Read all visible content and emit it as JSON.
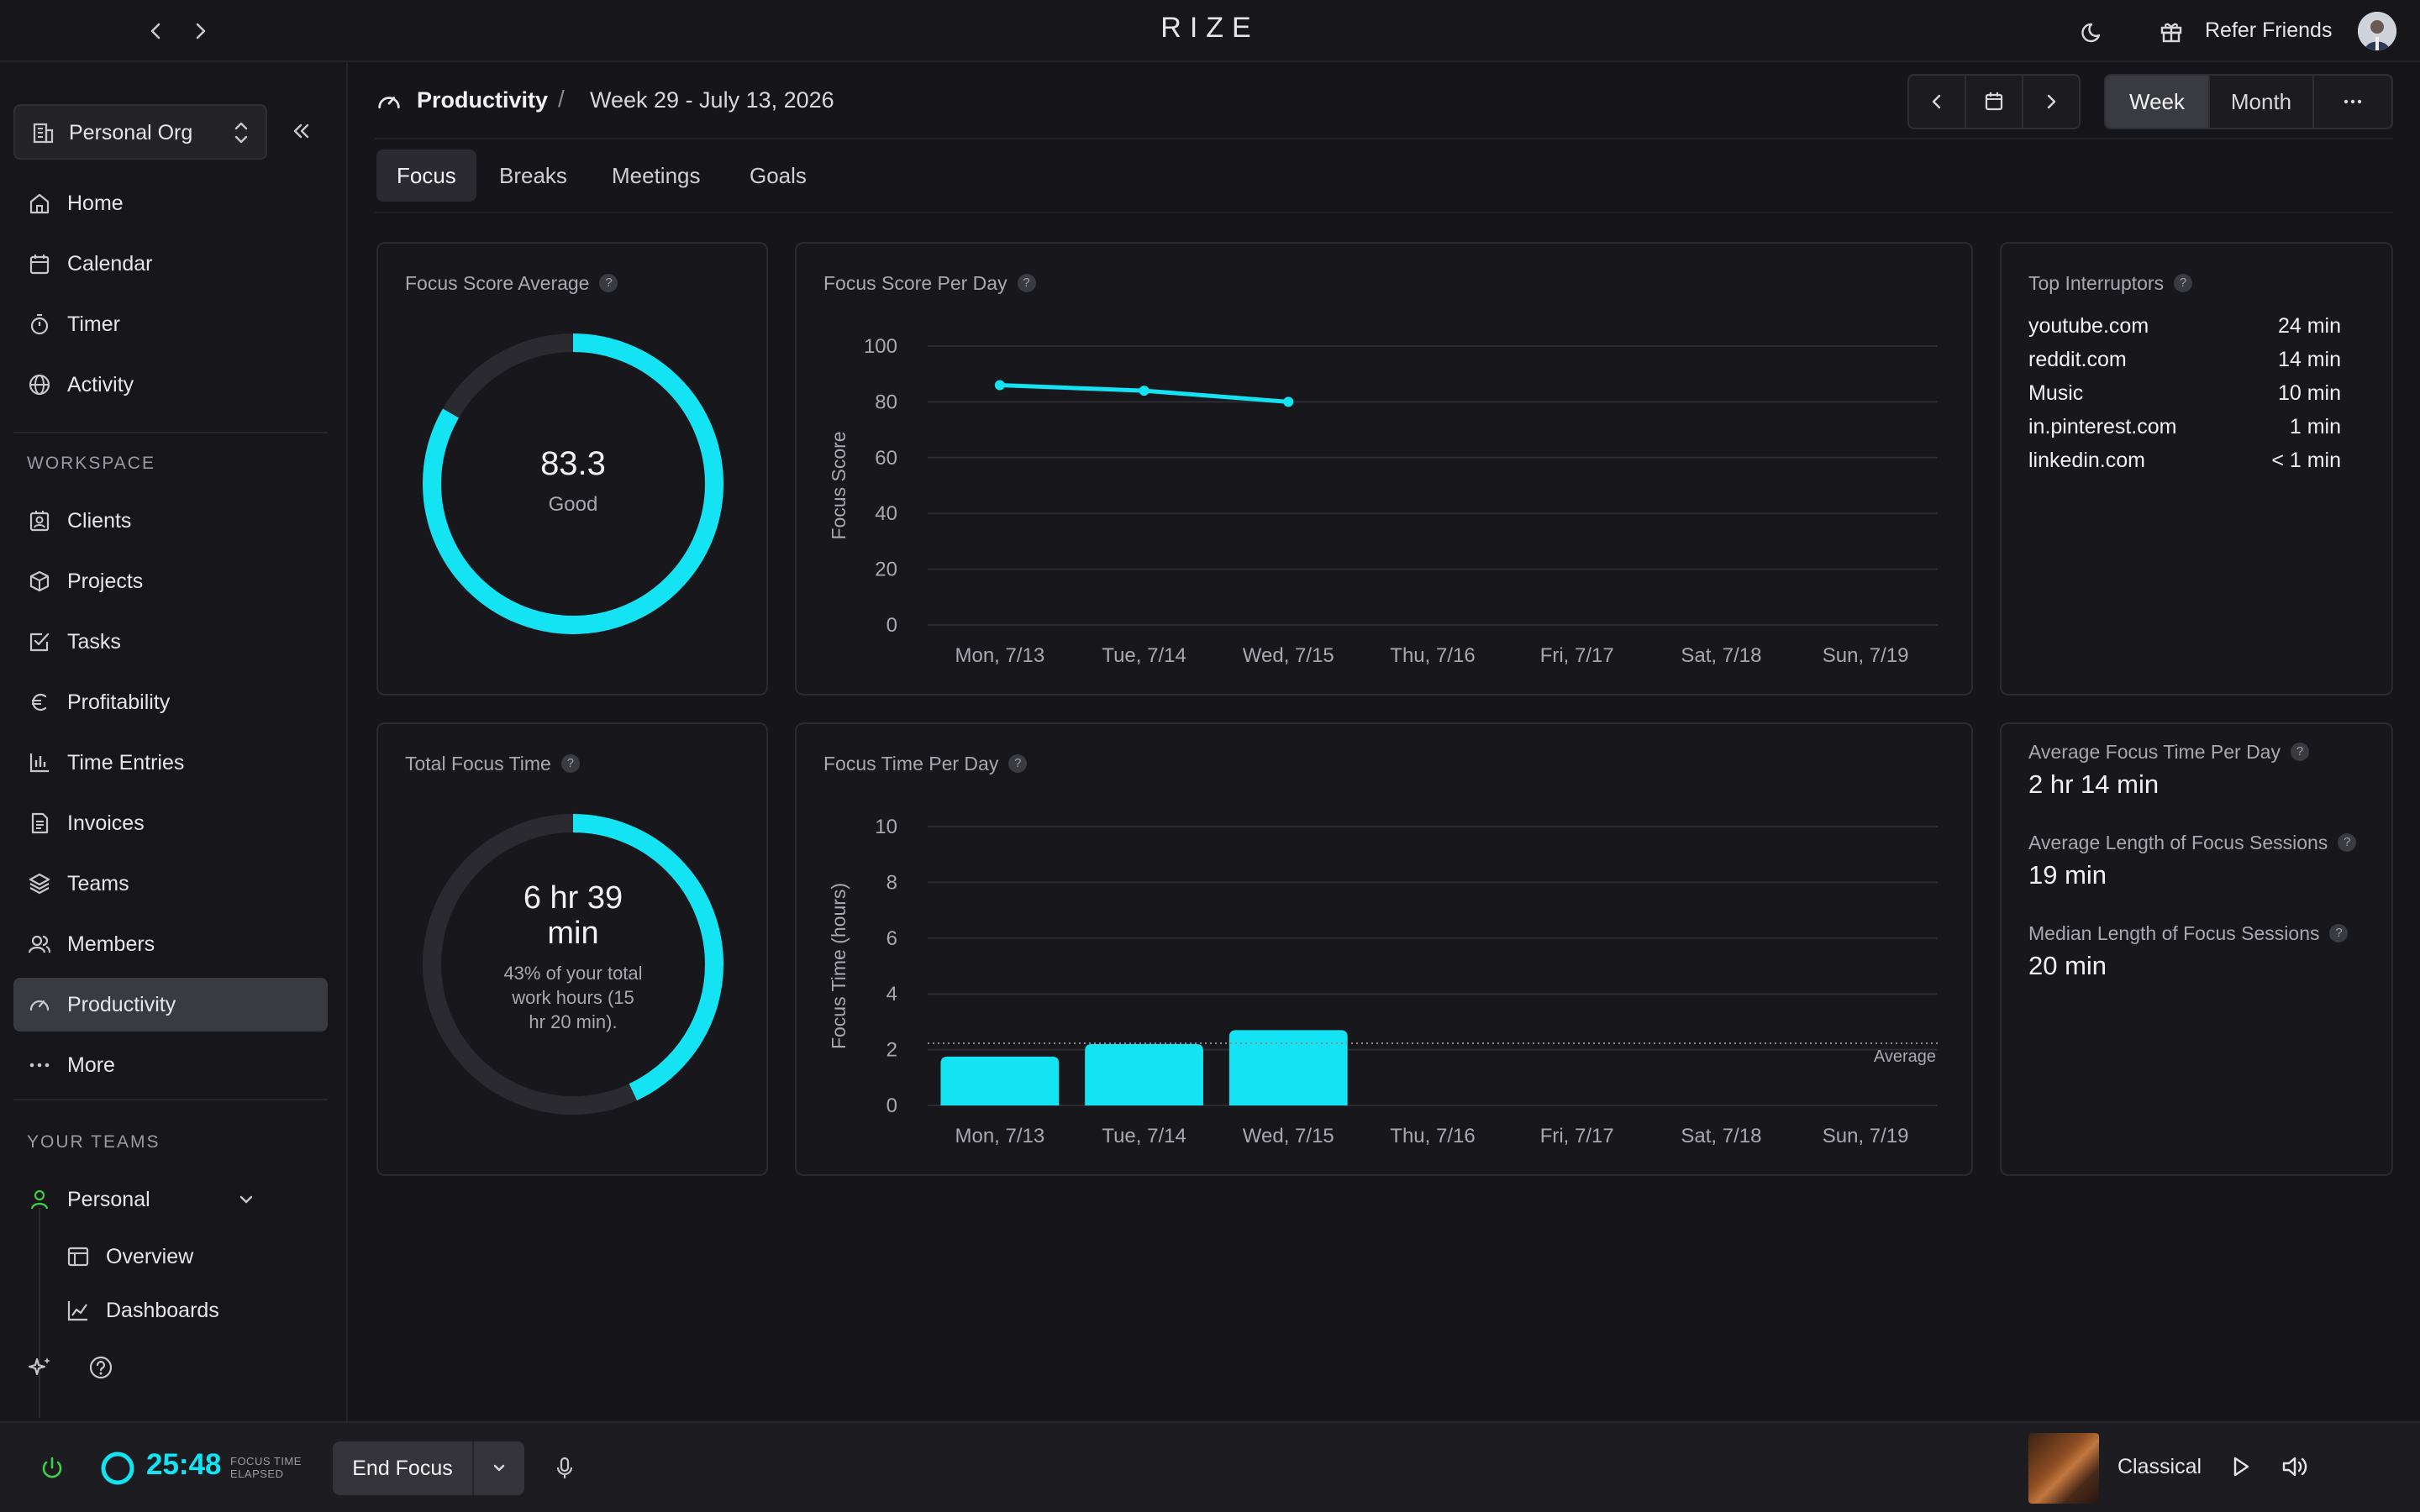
{
  "app": {
    "title": "RIZE",
    "refer_label": "Refer Friends"
  },
  "sidebar": {
    "org": "Personal Org",
    "items": [
      {
        "label": "Home",
        "icon": "home-icon"
      },
      {
        "label": "Calendar",
        "icon": "calendar-icon"
      },
      {
        "label": "Timer",
        "icon": "timer-icon"
      },
      {
        "label": "Activity",
        "icon": "globe-icon"
      }
    ],
    "workspace_label": "WORKSPACE",
    "workspace_items": [
      {
        "label": "Clients",
        "icon": "clients-icon"
      },
      {
        "label": "Projects",
        "icon": "box-icon"
      },
      {
        "label": "Tasks",
        "icon": "task-check-icon"
      },
      {
        "label": "Profitability",
        "icon": "euro-icon"
      },
      {
        "label": "Time Entries",
        "icon": "bar-chart-icon"
      },
      {
        "label": "Invoices",
        "icon": "invoice-icon"
      },
      {
        "label": "Teams",
        "icon": "layers-icon"
      },
      {
        "label": "Members",
        "icon": "members-icon"
      },
      {
        "label": "Productivity",
        "icon": "gauge-icon"
      },
      {
        "label": "More",
        "icon": "more-dots-icon"
      }
    ],
    "teams_label": "YOUR TEAMS",
    "team": {
      "label": "Personal",
      "icon": "person-icon"
    },
    "team_items": [
      {
        "label": "Overview",
        "icon": "layout-icon"
      },
      {
        "label": "Dashboards",
        "icon": "line-chart-icon"
      }
    ]
  },
  "header": {
    "title": "Productivity",
    "separator": "/",
    "week": "Week 29 - July 13, 2026",
    "range_options": [
      "Week",
      "Month"
    ],
    "range_selected": "Week"
  },
  "tabs": [
    "Focus",
    "Breaks",
    "Meetings",
    "Goals"
  ],
  "tab_selected": "Focus",
  "cards": {
    "focus_score_avg": {
      "title": "Focus Score Average",
      "value": "83.3",
      "rating": "Good",
      "percent": 83.3
    },
    "focus_score_per_day": {
      "title": "Focus Score Per Day"
    },
    "top_interruptors": {
      "title": "Top Interruptors",
      "rows": [
        {
          "name": "youtube.com",
          "time": "24 min"
        },
        {
          "name": "reddit.com",
          "time": "14 min"
        },
        {
          "name": "Music",
          "time": "10 min"
        },
        {
          "name": "in.pinterest.com",
          "time": "1 min"
        },
        {
          "name": "linkedin.com",
          "time": "< 1 min"
        }
      ]
    },
    "total_focus_time": {
      "title": "Total Focus Time",
      "value_line1": "6 hr 39",
      "value_line2": "min",
      "sub_line1": "43% of your total",
      "sub_line2": "work hours (15",
      "sub_line3": "hr 20 min).",
      "percent": 43
    },
    "focus_time_per_day": {
      "title": "Focus Time Per Day"
    },
    "stats": [
      {
        "label": "Average Focus Time Per Day",
        "value": "2 hr 14 min"
      },
      {
        "label": "Average Length of Focus Sessions",
        "value": "19 min"
      },
      {
        "label": "Median Length of Focus Sessions",
        "value": "20 min"
      }
    ]
  },
  "chart_data": [
    {
      "type": "line",
      "title": "Focus Score Per Day",
      "ylabel": "Focus Score",
      "categories": [
        "Mon, 7/13",
        "Tue, 7/14",
        "Wed, 7/15",
        "Thu, 7/16",
        "Fri, 7/17",
        "Sat, 7/18",
        "Sun, 7/19"
      ],
      "values": [
        86,
        84,
        80,
        null,
        null,
        null,
        null
      ],
      "yticks": [
        0,
        20,
        40,
        60,
        80,
        100
      ],
      "ylim": [
        0,
        100
      ],
      "grid": true,
      "color": "#14e3f3"
    },
    {
      "type": "bar",
      "title": "Focus Time Per Day",
      "ylabel": "Focus Time (hours)",
      "categories": [
        "Mon, 7/13",
        "Tue, 7/14",
        "Wed, 7/15",
        "Thu, 7/16",
        "Fri, 7/17",
        "Sat, 7/18",
        "Sun, 7/19"
      ],
      "values": [
        1.75,
        2.2,
        2.7,
        0,
        0,
        0,
        0
      ],
      "yticks": [
        0,
        2,
        4,
        6,
        8,
        10
      ],
      "ylim": [
        0,
        10
      ],
      "average": 2.23,
      "average_label": "Average",
      "grid": true,
      "color": "#14e3f3"
    }
  ],
  "bottom": {
    "timer": "25:48",
    "timer_sub": "FOCUS TIME ELAPSED",
    "end_focus": "End Focus",
    "track": "Classical"
  },
  "colors": {
    "accent": "#14e3f3",
    "ring_bg": "#2a2a30",
    "power": "#3ecf4a"
  }
}
